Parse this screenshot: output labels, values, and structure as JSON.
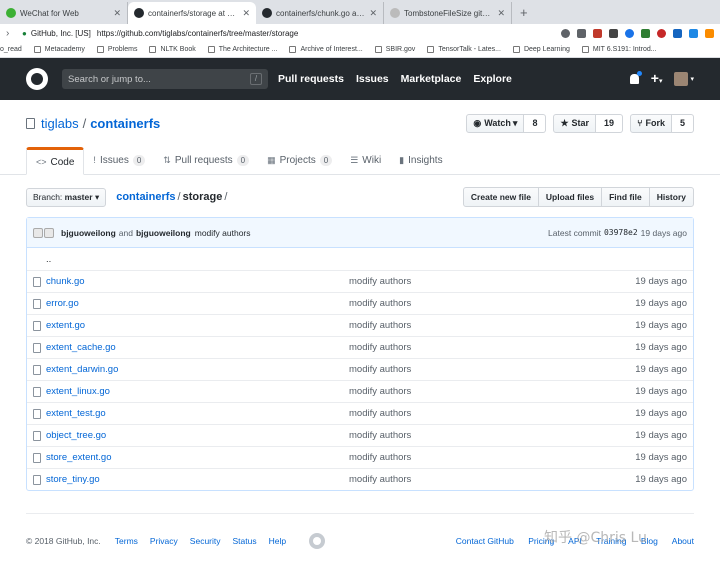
{
  "browser": {
    "tabs": [
      {
        "title": "WeChat for Web",
        "color": "#3cb034",
        "active": false
      },
      {
        "title": "containerfs/storage at master",
        "color": "#24292e",
        "active": true
      },
      {
        "title": "containerfs/chunk.go at master",
        "color": "#24292e",
        "active": false
      },
      {
        "title": "TombstoneFileSize github.com/c...",
        "color": "#bbbbbb",
        "active": false
      }
    ],
    "new_tab": "+",
    "site_identity": "GitHub, Inc. [US]",
    "url": "https://github.com/tiglabs/containerfs/tree/master/storage",
    "bookmarks": [
      "o_read",
      "Metacademy",
      "Problems",
      "NLTK Book",
      "The Architecture ...",
      "Archive of Interest...",
      "SBIR.gov",
      "TensorTalk - Lates...",
      "Deep Learning",
      "MIT 6.S191: Introd..."
    ]
  },
  "header": {
    "search_placeholder": "Search or jump to...",
    "search_shortcut": "/",
    "nav": [
      "Pull requests",
      "Issues",
      "Marketplace",
      "Explore"
    ],
    "plus": "+"
  },
  "repo": {
    "owner": "tiglabs",
    "separator": "/",
    "name": "containerfs",
    "watch_label": "Watch",
    "watch_count": "8",
    "star_label": "Star",
    "star_count": "19",
    "fork_label": "Fork",
    "fork_count": "5",
    "tabs": [
      {
        "label": "Code",
        "count": "",
        "icon": "<>"
      },
      {
        "label": "Issues",
        "count": "0",
        "icon": "!"
      },
      {
        "label": "Pull requests",
        "count": "0",
        "icon": "⇅"
      },
      {
        "label": "Projects",
        "count": "0",
        "icon": "▦"
      },
      {
        "label": "Wiki",
        "count": "",
        "icon": "☰"
      },
      {
        "label": "Insights",
        "count": "",
        "icon": "▮"
      }
    ]
  },
  "filenav": {
    "branch_prefix": "Branch:",
    "branch": "master",
    "crumb_root": "containerfs",
    "crumb_sep": "/",
    "crumb_current": "storage",
    "crumb_trail": "/",
    "buttons": [
      "Create new file",
      "Upload files",
      "Find file",
      "History"
    ]
  },
  "commit": {
    "author1": "bjguoweilong",
    "and": "and",
    "author2": "bjguoweilong",
    "message": "modify authors",
    "latest_label": "Latest commit",
    "sha": "03978e2",
    "age": "19 days ago"
  },
  "files": [
    {
      "name": "..",
      "message": "",
      "age": ""
    },
    {
      "name": "chunk.go",
      "message": "modify authors",
      "age": "19 days ago"
    },
    {
      "name": "error.go",
      "message": "modify authors",
      "age": "19 days ago"
    },
    {
      "name": "extent.go",
      "message": "modify authors",
      "age": "19 days ago"
    },
    {
      "name": "extent_cache.go",
      "message": "modify authors",
      "age": "19 days ago"
    },
    {
      "name": "extent_darwin.go",
      "message": "modify authors",
      "age": "19 days ago"
    },
    {
      "name": "extent_linux.go",
      "message": "modify authors",
      "age": "19 days ago"
    },
    {
      "name": "extent_test.go",
      "message": "modify authors",
      "age": "19 days ago"
    },
    {
      "name": "object_tree.go",
      "message": "modify authors",
      "age": "19 days ago"
    },
    {
      "name": "store_extent.go",
      "message": "modify authors",
      "age": "19 days ago"
    },
    {
      "name": "store_tiny.go",
      "message": "modify authors",
      "age": "19 days ago"
    }
  ],
  "footer": {
    "copyright": "© 2018 GitHub, Inc.",
    "left_links": [
      "Terms",
      "Privacy",
      "Security",
      "Status",
      "Help"
    ],
    "right_links": [
      "Contact GitHub",
      "Pricing",
      "API",
      "Training",
      "Blog",
      "About"
    ]
  },
  "watermark": "知乎 @Chris Lu"
}
